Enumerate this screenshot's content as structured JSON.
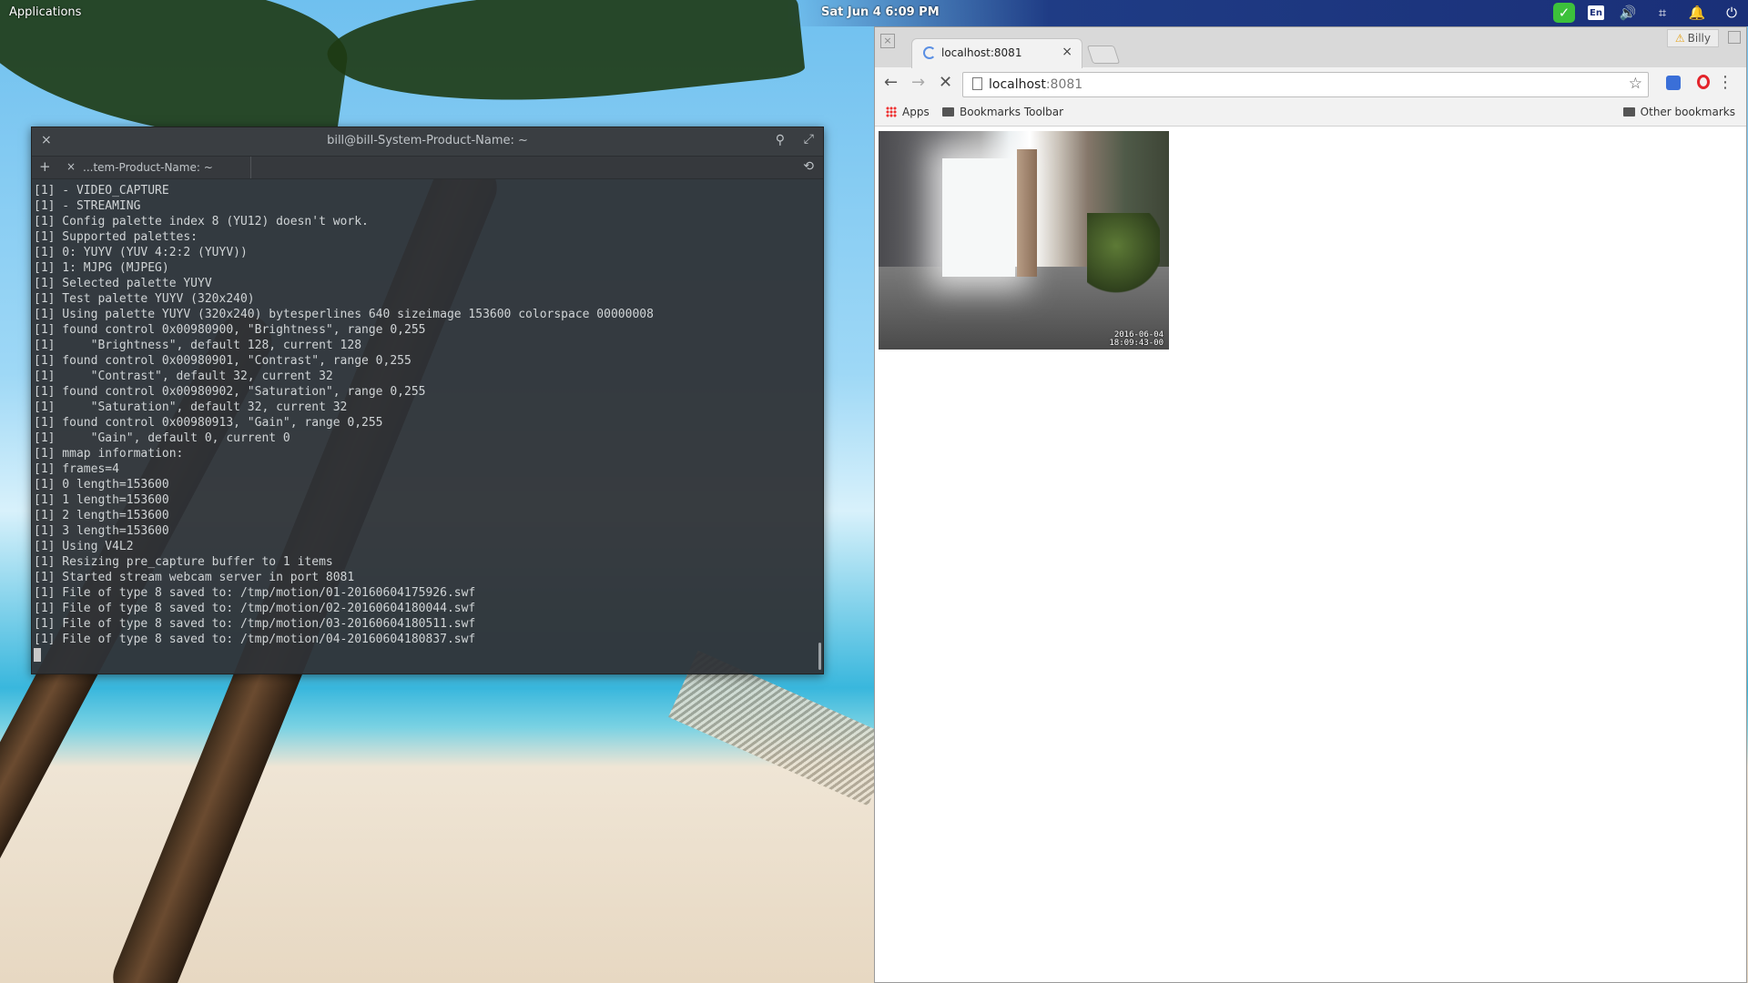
{
  "top_panel": {
    "applications": "Applications",
    "clock": "Sat Jun 4   6:09 PM",
    "tray": {
      "check": "✓",
      "lang": "En",
      "volume": "🔊",
      "network": "⌗",
      "bell": "🔔",
      "power": "⏻"
    }
  },
  "terminal": {
    "close": "×",
    "title": "bill@bill-System-Product-Name: ~",
    "search": "⚲",
    "expand": "⤢",
    "add": "+",
    "tab_close": "×",
    "tab_label": "...tem-Product-Name: ~",
    "history": "⟲",
    "lines": [
      "[1] - VIDEO_CAPTURE",
      "[1] - STREAMING",
      "[1] Config palette index 8 (YU12) doesn't work.",
      "[1] Supported palettes:",
      "[1] 0: YUYV (YUV 4:2:2 (YUYV))",
      "[1] 1: MJPG (MJPEG)",
      "[1] Selected palette YUYV",
      "[1] Test palette YUYV (320x240)",
      "[1] Using palette YUYV (320x240) bytesperlines 640 sizeimage 153600 colorspace 00000008",
      "[1] found control 0x00980900, \"Brightness\", range 0,255",
      "[1]     \"Brightness\", default 128, current 128",
      "[1] found control 0x00980901, \"Contrast\", range 0,255",
      "[1]     \"Contrast\", default 32, current 32",
      "[1] found control 0x00980902, \"Saturation\", range 0,255",
      "[1]     \"Saturation\", default 32, current 32",
      "[1] found control 0x00980913, \"Gain\", range 0,255",
      "[1]     \"Gain\", default 0, current 0",
      "[1] mmap information:",
      "[1] frames=4",
      "[1] 0 length=153600",
      "[1] 1 length=153600",
      "[1] 2 length=153600",
      "[1] 3 length=153600",
      "[1] Using V4L2",
      "[1] Resizing pre_capture buffer to 1 items",
      "[1] Started stream webcam server in port 8081",
      "[1] File of type 8 saved to: /tmp/motion/01-20160604175926.swf",
      "[1] File of type 8 saved to: /tmp/motion/02-20160604180044.swf",
      "[1] File of type 8 saved to: /tmp/motion/03-20160604180511.swf",
      "[1] File of type 8 saved to: /tmp/motion/04-20160604180837.swf"
    ]
  },
  "browser": {
    "tab_title": "localhost:8081",
    "tab_close": "×",
    "window_close": "×",
    "profile_name": "Billy",
    "profile_warning": "⚠",
    "back": "←",
    "forward": "→",
    "stop": "✕",
    "url_host": "localhost",
    "url_port": ":8081",
    "star": "☆",
    "menu": "⋮",
    "bookmarks": {
      "apps": "Apps",
      "toolbar": "Bookmarks Toolbar",
      "other": "Other bookmarks"
    },
    "webcam_timestamp_date": "2016-06-04",
    "webcam_timestamp_time": "18:09:43-00"
  }
}
